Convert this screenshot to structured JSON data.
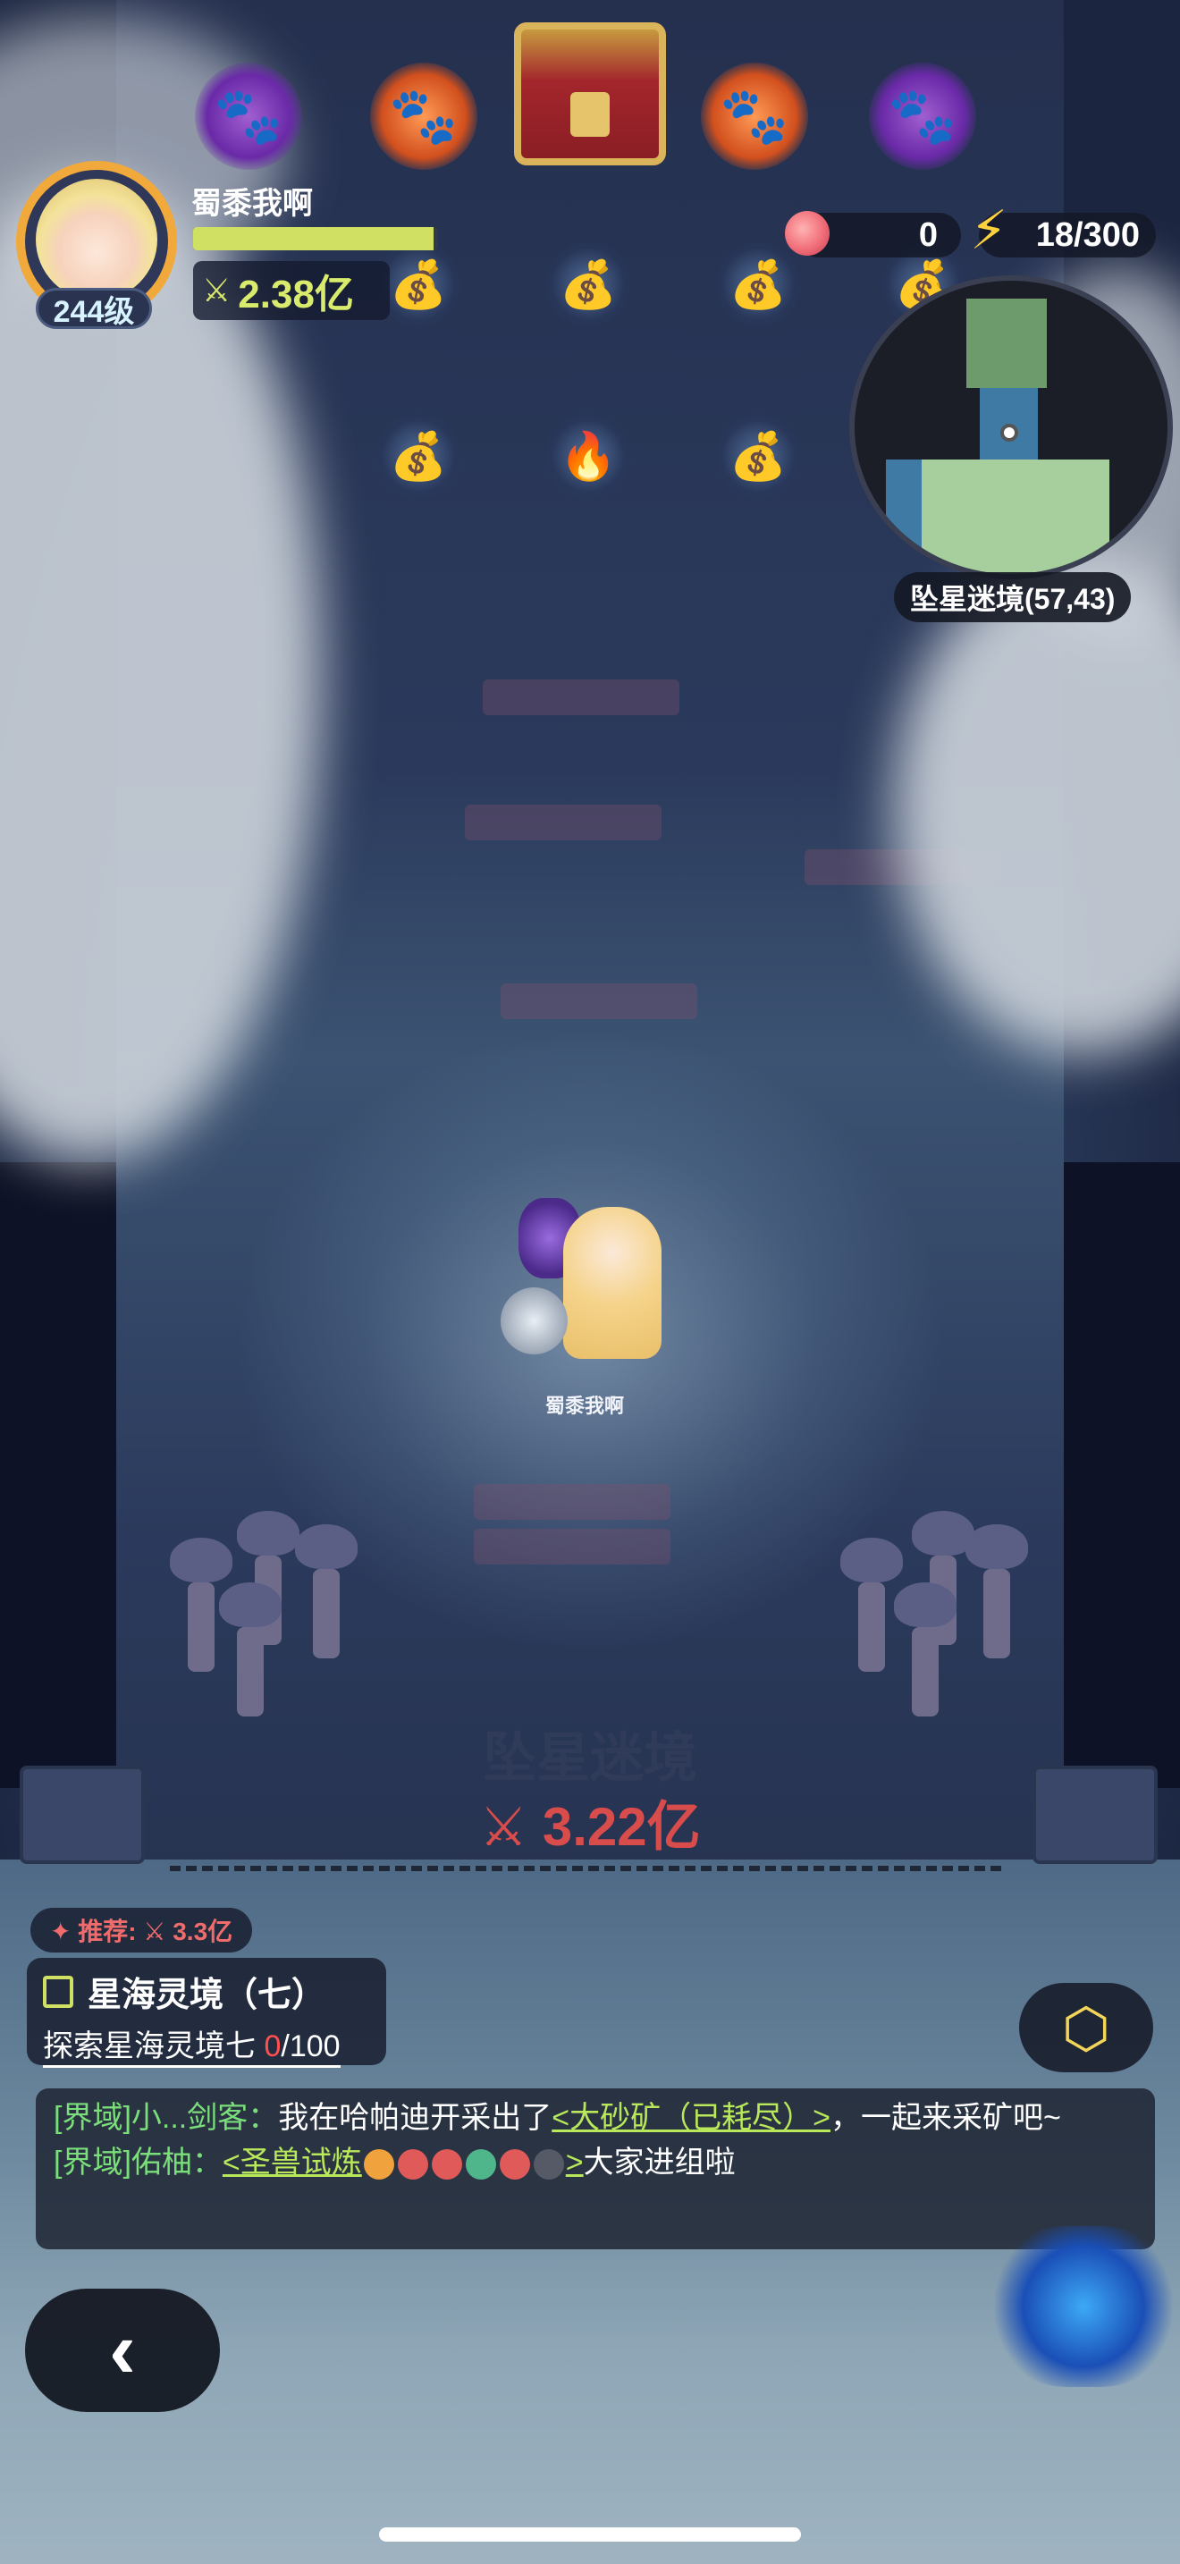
{
  "top_bar": {
    "items": [
      {
        "name": "paw-gift-purple-left",
        "glyph": "🐾"
      },
      {
        "name": "paw-gift-orange-left",
        "glyph": "🐾"
      },
      {
        "name": "treasure-chest"
      },
      {
        "name": "paw-gift-orange-right",
        "glyph": "🐾"
      },
      {
        "name": "paw-gift-purple-right",
        "glyph": "🐾"
      }
    ]
  },
  "player": {
    "name": "蜀黍我啊",
    "level": "244级",
    "hp_fraction": 0.98,
    "power_icon": "swords-icon",
    "power_symbol": "⚔",
    "power": "2.38亿"
  },
  "resources": {
    "peach": "0",
    "energy": "18/300"
  },
  "minimap": {
    "label": "坠星迷境(57,43)"
  },
  "character": {
    "name": "蜀黍我啊"
  },
  "area": {
    "title": "坠星迷境",
    "power_symbol": "⚔",
    "power": "3.22亿"
  },
  "quest": {
    "recommend": "✦ 推荐: ⚔ 3.3亿",
    "title": "星海灵境（七）",
    "desc_prefix": "探索星海灵境七 ",
    "desc_current": "0",
    "desc_total": "/100"
  },
  "chat": {
    "line1_channel": "[界域]",
    "line1_user": "小...剑客：",
    "line1_text": "我在哈帕迪开采出了",
    "line1_link": "<大砂矿（已耗尽）>",
    "line1_tail": "，一起来采矿吧~",
    "line2_channel": "[界域]",
    "line2_user": "佑柚：",
    "line2_link_start": "<圣兽试炼",
    "line2_link_end": ">",
    "line2_tail": "大家进组啦"
  },
  "colors": {
    "accent_green": "#cfe063",
    "power_red": "#d84c4c",
    "chat_green": "#7adf7a"
  }
}
